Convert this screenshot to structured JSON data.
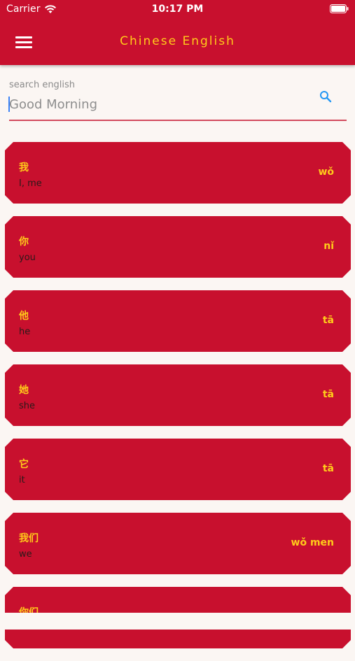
{
  "status_bar": {
    "carrier": "Carrier",
    "time": "10:17 PM"
  },
  "header": {
    "title": "Chinese English",
    "background_color": "#c8102e",
    "title_color": "#ffcc1a"
  },
  "search": {
    "label": "search english",
    "placeholder": "Good Morning",
    "value": ""
  },
  "words": [
    {
      "chinese": "我",
      "english": "I, me",
      "pinyin": "wǒ"
    },
    {
      "chinese": "你",
      "english": "you",
      "pinyin": "nǐ"
    },
    {
      "chinese": "他",
      "english": "he",
      "pinyin": "tā"
    },
    {
      "chinese": "她",
      "english": "she",
      "pinyin": "tā"
    },
    {
      "chinese": "它",
      "english": "it",
      "pinyin": "tā"
    },
    {
      "chinese": "我们",
      "english": "we",
      "pinyin": "wǒ men"
    },
    {
      "chinese": "你们",
      "english": "",
      "pinyin": ""
    }
  ]
}
